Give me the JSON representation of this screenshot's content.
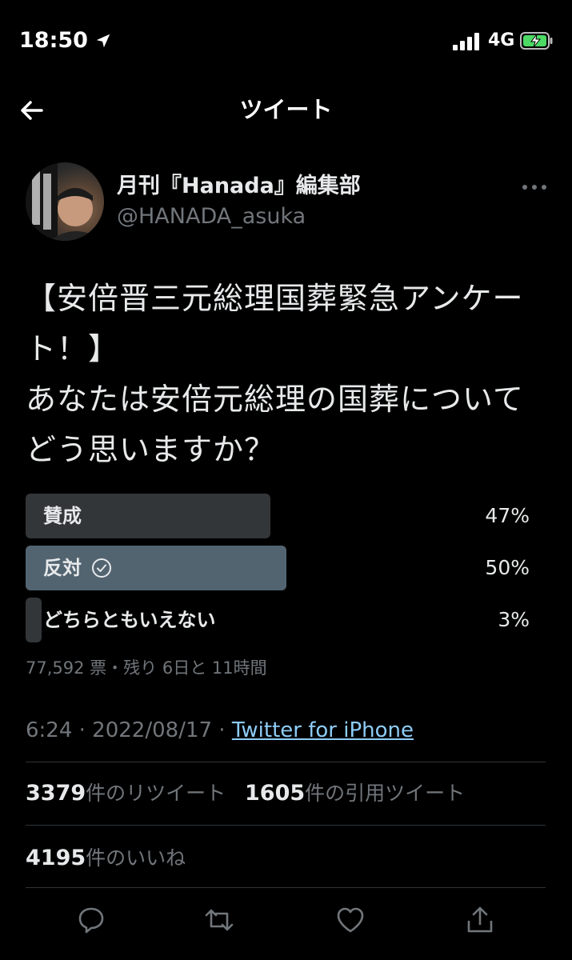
{
  "status_bar": {
    "time": "18:50",
    "network": "4G",
    "icons": [
      "location-arrow-icon",
      "signal-bars-icon",
      "battery-charging-icon"
    ]
  },
  "header": {
    "title": "ツイート",
    "back_icon": "back-arrow-icon"
  },
  "tweet": {
    "author": {
      "name": "月刊『Hanada』編集部",
      "handle": "@HANADA_asuka"
    },
    "text": "【安倍晋三元総理国葬緊急アンケート！】\nあなたは安倍元総理の国葬についてどう思いますか？",
    "poll": {
      "options": [
        {
          "label": "賛成",
          "percent": "47%",
          "fraction": 0.47,
          "winner": false
        },
        {
          "label": "反対",
          "percent": "50%",
          "fraction": 0.5,
          "winner": true
        },
        {
          "label": "どちらともいえない",
          "percent": "3%",
          "fraction": 0.03,
          "winner": false
        }
      ],
      "meta": "77,592 票・残り 6日と 11時間"
    },
    "time_line": "6:24 · 2022/08/17 · ",
    "source": "Twitter for iPhone",
    "retweets_count": "3379",
    "retweets_label": "件のリツイート",
    "quotes_count": "1605",
    "quotes_label": "件の引用ツイート",
    "likes_count": "4195",
    "likes_label": "件のいいね"
  },
  "colors": {
    "background": "#000000",
    "text": "#e7e9ea",
    "secondary": "#71767b",
    "poll_bar": "#333639",
    "poll_bar_winner": "#536471",
    "link": "#8ecdf8"
  },
  "actions": [
    "reply-icon",
    "retweet-icon",
    "like-icon",
    "share-icon"
  ]
}
